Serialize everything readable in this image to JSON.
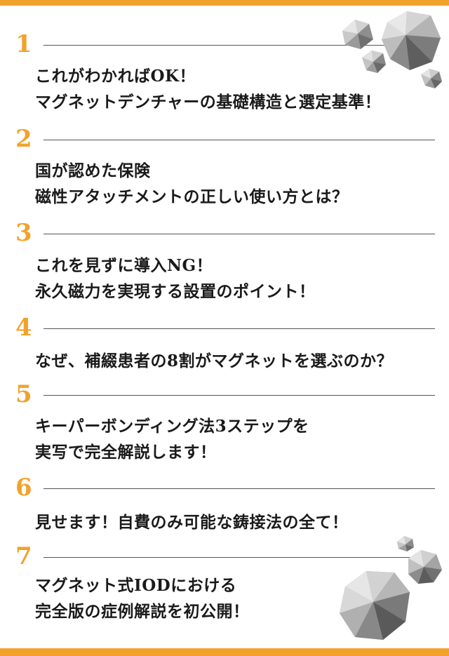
{
  "items": [
    {
      "number": "1",
      "lines": [
        "これがわかればOK！",
        "マグネットデンチャーの基礎構造と選定基準！"
      ]
    },
    {
      "number": "2",
      "lines": [
        "国が認めた保険",
        "磁性アタッチメントの正しい使い方とは？"
      ]
    },
    {
      "number": "3",
      "lines": [
        "これを見ずに導入NG！",
        "永久磁力を実現する設置のポイント！"
      ]
    },
    {
      "number": "4",
      "lines": [
        "なぜ、補綴患者の8割がマグネットを選ぶのか？"
      ]
    },
    {
      "number": "5",
      "lines": [
        "キーパーボンディング法3ステップを",
        "実写で完全解説します！"
      ]
    },
    {
      "number": "6",
      "lines": [
        "見せます！自費のみ可能な鋳接法の全て！"
      ]
    },
    {
      "number": "7",
      "lines": [
        "マグネット式IODにおける",
        "完全版の症例解説を初公開！"
      ]
    }
  ],
  "colors": {
    "accent": "#f2a22b",
    "text": "#1a1a1a",
    "rule": "#555555"
  },
  "decorations": [
    "silver-polyhedron-cluster-top-right",
    "silver-polyhedron-cluster-bottom-right"
  ]
}
